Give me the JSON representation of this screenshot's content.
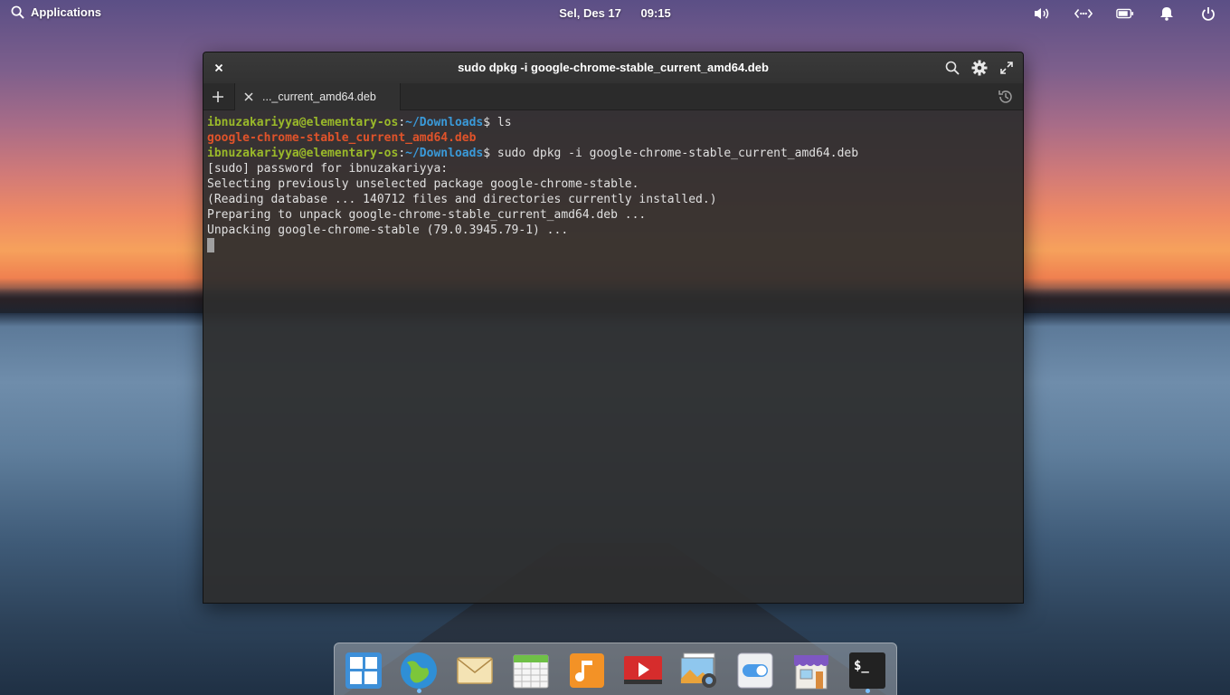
{
  "panel": {
    "applications_label": "Applications",
    "date": "Sel, Des 17",
    "time": "09:15",
    "indicators": [
      "volume-icon",
      "network-icon",
      "battery-icon",
      "notifications-icon",
      "power-icon"
    ]
  },
  "window": {
    "title": "sudo dpkg -i google-chrome-stable_current_amd64.deb",
    "tab_label": "..._current_amd64.deb"
  },
  "terminal": {
    "user_host": "ibnuzakariyya@elementary-os",
    "path": "~/Downloads",
    "cmd1": " ls",
    "file": "google-chrome-stable_current_amd64.deb",
    "cmd2": " sudo dpkg -i google-chrome-stable_current_amd64.deb",
    "out1": "[sudo] password for ibnuzakariyya:",
    "out2": "Selecting previously unselected package google-chrome-stable.",
    "out3": "(Reading database ... 140712 files and directories currently installed.)",
    "out4": "Preparing to unpack google-chrome-stable_current_amd64.deb ...",
    "out5": "Unpacking google-chrome-stable (79.0.3945.79-1) ..."
  },
  "dock": {
    "apps": [
      "multitasking-view-icon",
      "web-browser-icon",
      "mail-icon",
      "calendar-icon",
      "music-icon",
      "videos-icon",
      "photos-icon",
      "system-settings-icon",
      "appcenter-icon",
      "terminal-icon"
    ]
  }
}
